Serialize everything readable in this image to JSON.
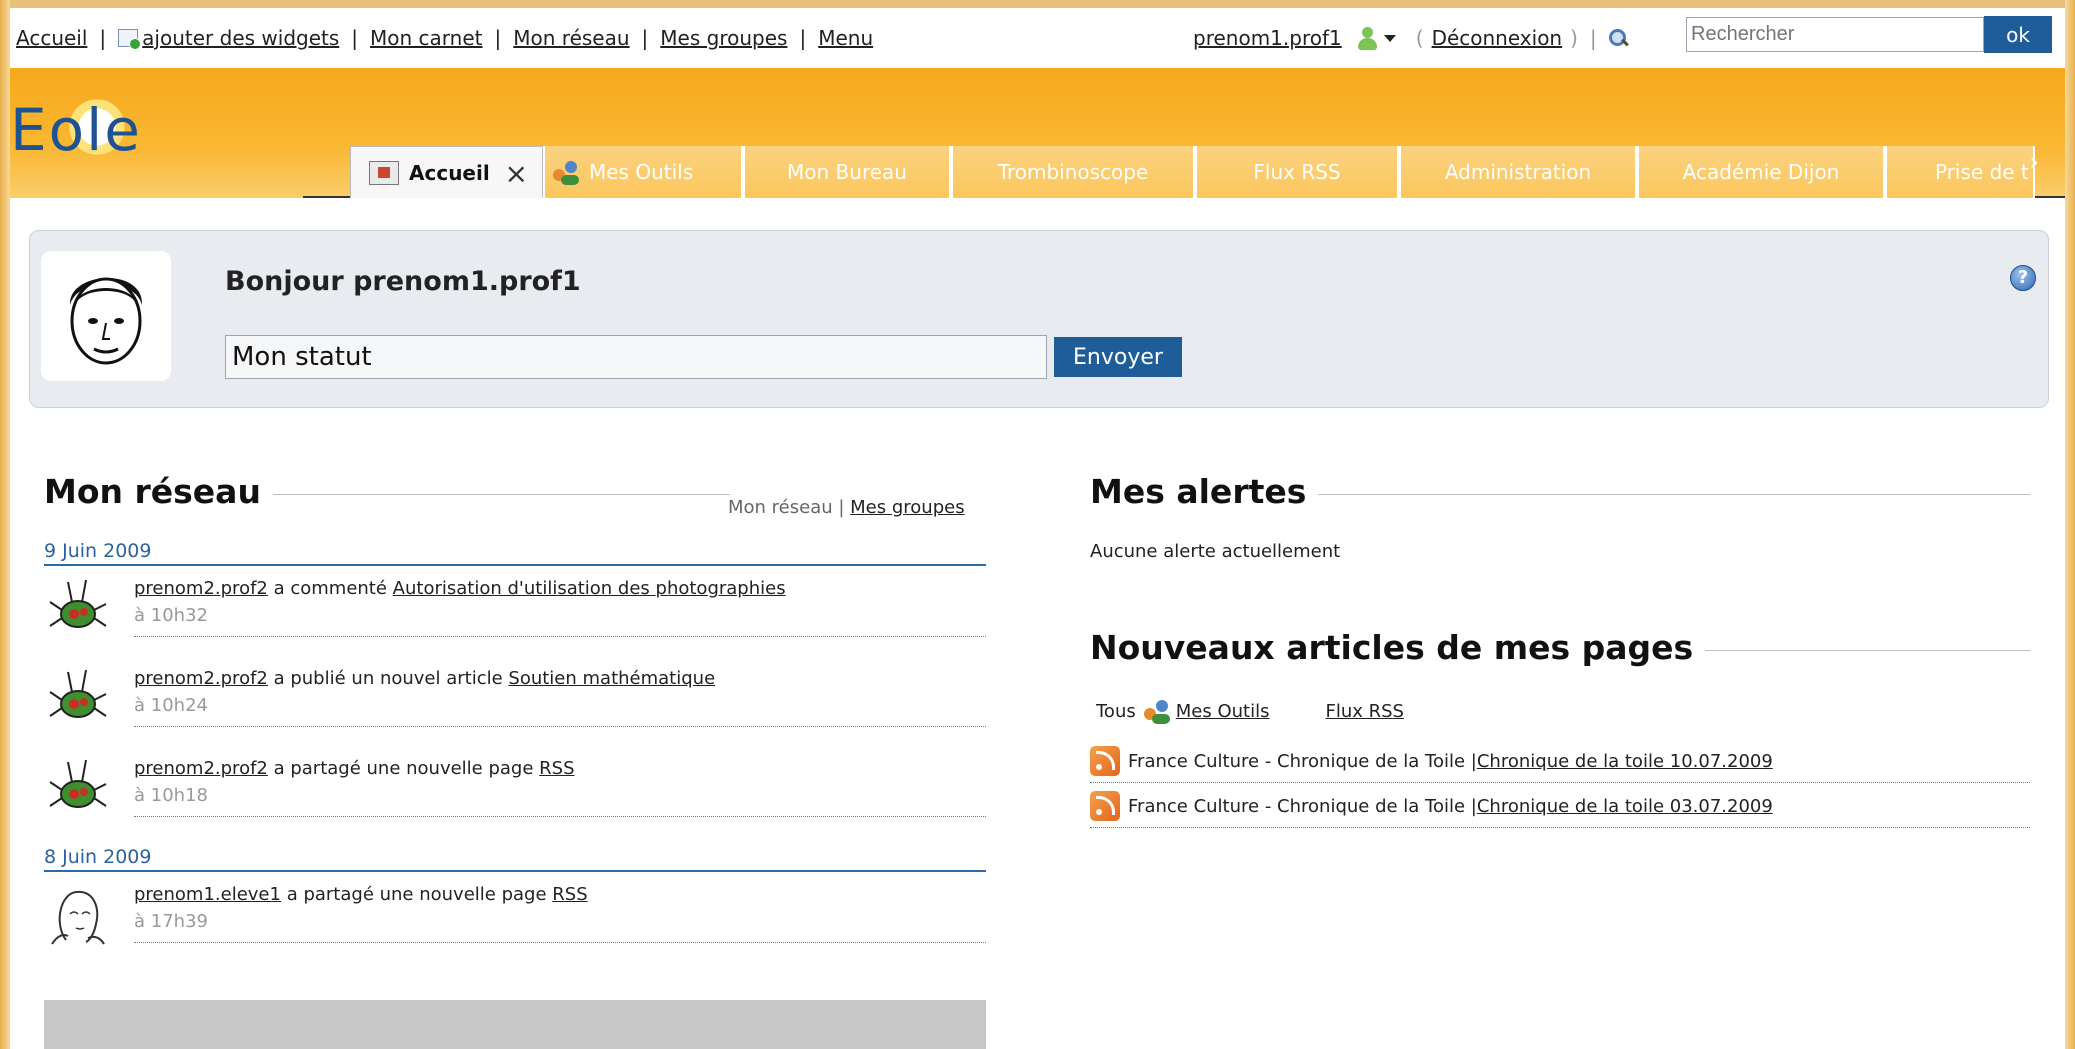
{
  "topbar": {
    "nav": [
      "Accueil",
      "ajouter des widgets",
      "Mon carnet",
      "Mon réseau",
      "Mes groupes",
      "Menu"
    ],
    "username": "prenom1.prof1",
    "logout": "Déconnexion",
    "search_placeholder": "Rechercher",
    "ok": "ok",
    "paren_open": "(",
    "paren_close": ")",
    "pipe": "|"
  },
  "logo": {
    "text": "Eole"
  },
  "tabs": [
    {
      "label": "Accueil",
      "active": true
    },
    {
      "label": "Mes Outils"
    },
    {
      "label": "Mon Bureau"
    },
    {
      "label": "Trombinoscope"
    },
    {
      "label": "Flux RSS"
    },
    {
      "label": "Administration"
    },
    {
      "label": "Académie Dijon"
    },
    {
      "label": "Prise de t"
    }
  ],
  "tab_close": "×",
  "tab_scroll": "›",
  "status": {
    "greeting": "Bonjour prenom1.prof1",
    "input_value": "Mon statut",
    "send": "Envoyer",
    "help": "?"
  },
  "network": {
    "title": "Mon réseau",
    "links_plain": "Mon réseau | ",
    "links_link": "Mes groupes",
    "groups": [
      {
        "date": "9 Juin 2009",
        "items": [
          {
            "user": "prenom2.prof2",
            "action": " a commenté ",
            "target": "Autorisation d'utilisation des photographies",
            "time": "à 10h32"
          },
          {
            "user": "prenom2.prof2",
            "action": " a publié un nouvel article ",
            "target": "Soutien mathématique",
            "time": "à 10h24"
          },
          {
            "user": "prenom2.prof2",
            "action": " a partagé une nouvelle page ",
            "target": "RSS",
            "time": "à 10h18"
          }
        ]
      },
      {
        "date": "8 Juin 2009",
        "items": [
          {
            "user": "prenom1.eleve1",
            "action": " a partagé une nouvelle page ",
            "target": "RSS",
            "time": "à 17h39"
          }
        ]
      }
    ]
  },
  "alerts": {
    "title": "Mes alertes",
    "empty": "Aucune alerte actuellement"
  },
  "articles": {
    "title": "Nouveaux articles de mes pages",
    "filter_all": "Tous",
    "filter_tools": "Mes Outils",
    "filter_rss": "Flux RSS",
    "items": [
      {
        "source": "France Culture - Chronique de la Toile | ",
        "link": "Chronique de la toile 10.07.2009"
      },
      {
        "source": "France Culture - Chronique de la Toile | ",
        "link": "Chronique de la toile 03.07.2009"
      }
    ]
  },
  "colors": {
    "accent": "#1e5d99",
    "header_orange": "#f7a81b",
    "date_blue": "#2a63a0"
  }
}
